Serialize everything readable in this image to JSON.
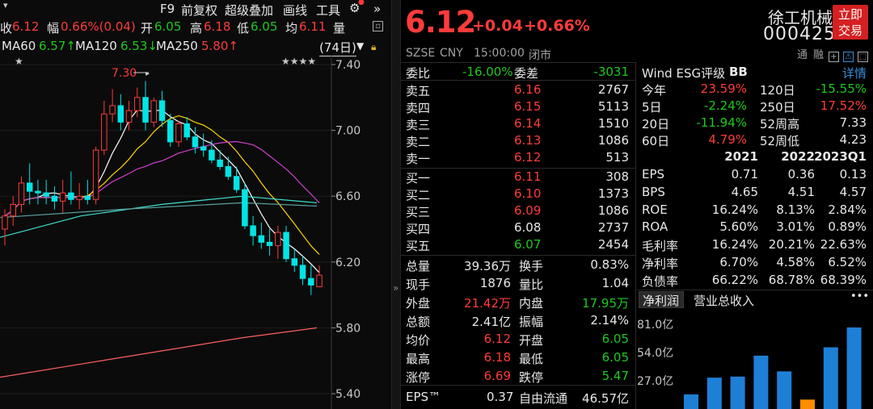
{
  "toolbar": {
    "f9": "F9",
    "restore": "前复权",
    "overlay": "超级叠加",
    "draw": "画线",
    "tools": "工具"
  },
  "ohlc": {
    "close_label": "收",
    "close": "6.12",
    "change_label": "幅",
    "change": "0.66%(0.04)",
    "open_label": "开",
    "open": "6.05",
    "high_label": "高",
    "high": "6.18",
    "low_label": "低",
    "low": "6.05",
    "avg_label": "均",
    "avg": "6.11",
    "volume_label": "量"
  },
  "ma": {
    "ma60_label": "MA60",
    "ma60": "6.57↑",
    "ma120_label": "MA120",
    "ma120": "6.53↓",
    "ma250_label": "MA250",
    "ma250": "5.80↑",
    "period": "(74日)"
  },
  "chart": {
    "y_ticks": [
      "7.40",
      "7.00",
      "6.60",
      "6.20",
      "5.80",
      "5.40"
    ],
    "high_annotation": "7.30",
    "stars_left": "★",
    "stars_right": "★★★★",
    "colors": {
      "up": "#ff3b3b",
      "down": "#00e5e5",
      "ma5": "#ffffff",
      "ma10": "#ffd700",
      "ma20": "#d040d0",
      "ma60": "#40e0d0",
      "ma250": "#ff6060"
    }
  },
  "chart_data": {
    "type": "candlestick",
    "ylim": [
      5.4,
      7.4
    ],
    "candles": [
      [
        6.4,
        6.52,
        6.3,
        6.48
      ],
      [
        6.48,
        6.6,
        6.42,
        6.55
      ],
      [
        6.55,
        6.72,
        6.5,
        6.68
      ],
      [
        6.68,
        6.8,
        6.55,
        6.63
      ],
      [
        6.63,
        6.7,
        6.55,
        6.62
      ],
      [
        6.62,
        6.7,
        6.55,
        6.6
      ],
      [
        6.6,
        6.66,
        6.52,
        6.57
      ],
      [
        6.57,
        6.7,
        6.5,
        6.62
      ],
      [
        6.62,
        6.75,
        6.55,
        6.58
      ],
      [
        6.58,
        6.68,
        6.52,
        6.6
      ],
      [
        6.6,
        6.7,
        6.55,
        6.58
      ],
      [
        6.58,
        6.9,
        6.55,
        6.88
      ],
      [
        6.88,
        7.18,
        6.85,
        7.1
      ],
      [
        7.1,
        7.25,
        7.05,
        7.15
      ],
      [
        7.15,
        7.22,
        7.0,
        7.05
      ],
      [
        7.05,
        7.18,
        7.0,
        7.12
      ],
      [
        7.12,
        7.26,
        7.08,
        7.2
      ],
      [
        7.2,
        7.3,
        7.0,
        7.05
      ],
      [
        7.05,
        7.2,
        7.02,
        7.18
      ],
      [
        7.18,
        7.24,
        7.02,
        7.06
      ],
      [
        7.06,
        7.1,
        6.9,
        6.93
      ],
      [
        6.93,
        7.06,
        6.9,
        7.04
      ],
      [
        7.04,
        7.08,
        6.94,
        6.96
      ],
      [
        6.96,
        7.02,
        6.86,
        6.9
      ],
      [
        6.9,
        6.98,
        6.84,
        6.88
      ],
      [
        6.88,
        6.94,
        6.8,
        6.82
      ],
      [
        6.82,
        6.88,
        6.76,
        6.78
      ],
      [
        6.78,
        6.84,
        6.7,
        6.72
      ],
      [
        6.72,
        6.78,
        6.62,
        6.64
      ],
      [
        6.64,
        6.68,
        6.4,
        6.42
      ],
      [
        6.42,
        6.48,
        6.3,
        6.36
      ],
      [
        6.36,
        6.44,
        6.28,
        6.32
      ],
      [
        6.32,
        6.4,
        6.24,
        6.3
      ],
      [
        6.3,
        6.42,
        6.22,
        6.38
      ],
      [
        6.38,
        6.42,
        6.2,
        6.22
      ],
      [
        6.22,
        6.28,
        6.14,
        6.18
      ],
      [
        6.18,
        6.24,
        6.06,
        6.1
      ],
      [
        6.1,
        6.18,
        6.0,
        6.06
      ],
      [
        6.05,
        6.18,
        6.05,
        6.12
      ]
    ]
  },
  "quote": {
    "price": "6.12",
    "change": "+0.04",
    "change_pct": "+0.66%",
    "name": "徐工机械",
    "code": "000425",
    "trade_button": "立即交易",
    "exchange": "SZSE",
    "currency": "CNY",
    "time": "15:00:00",
    "status": "闭市",
    "flags": [
      "通",
      "融"
    ]
  },
  "orderbook": {
    "wb_label": "委比",
    "wb": "-16.00%",
    "wc_label": "委差",
    "wc": "-3031",
    "asks": [
      {
        "label": "卖五",
        "price": "6.16",
        "vol": "2767"
      },
      {
        "label": "卖四",
        "price": "6.15",
        "vol": "5113"
      },
      {
        "label": "卖三",
        "price": "6.14",
        "vol": "1510"
      },
      {
        "label": "卖二",
        "price": "6.13",
        "vol": "1086"
      },
      {
        "label": "卖一",
        "price": "6.12",
        "vol": "513"
      }
    ],
    "bids": [
      {
        "label": "买一",
        "price": "6.11",
        "vol": "308"
      },
      {
        "label": "买二",
        "price": "6.10",
        "vol": "1373"
      },
      {
        "label": "买三",
        "price": "6.09",
        "vol": "1086"
      },
      {
        "label": "买四",
        "price": "6.08",
        "vol": "2737"
      },
      {
        "label": "买五",
        "price": "6.07",
        "vol": "2454"
      }
    ]
  },
  "stats": [
    {
      "l1": "总量",
      "v1": "39.36万",
      "l2": "换手",
      "v2": "0.83%"
    },
    {
      "l1": "现手",
      "v1": "1876",
      "l2": "量比",
      "v2": "1.04"
    },
    {
      "l1": "外盘",
      "v1": "21.42万",
      "l2": "内盘",
      "v2": "17.95万"
    },
    {
      "l1": "总额",
      "v1": "2.41亿",
      "l2": "振幅",
      "v2": "2.14%"
    },
    {
      "l1": "均价",
      "v1": "6.12",
      "l2": "开盘",
      "v2": "6.05"
    },
    {
      "l1": "最高",
      "v1": "6.18",
      "l2": "最低",
      "v2": "6.05"
    },
    {
      "l1": "涨停",
      "v1": "6.69",
      "l2": "跌停",
      "v2": "5.47"
    }
  ],
  "bottom": {
    "l1": "EPS™",
    "v1": "0.37",
    "l2": "自由流通",
    "v2": "46.57亿"
  },
  "esg": {
    "label": "Wind ESG评级",
    "rating": "BB",
    "detail": "详情"
  },
  "perf": [
    {
      "l1": "今年",
      "v1": "23.59%",
      "l2": "120日",
      "v2": "-15.55%"
    },
    {
      "l1": "5日",
      "v1": "-2.24%",
      "l2": "250日",
      "v2": "17.52%"
    },
    {
      "l1": "20日",
      "v1": "-11.94%",
      "l2": "52周高",
      "v2": "7.33"
    },
    {
      "l1": "60日",
      "v1": "4.79%",
      "l2": "52周低",
      "v2": "4.23"
    }
  ],
  "fin": {
    "years": [
      "2021",
      "2022",
      "2023Q1"
    ],
    "rows": [
      {
        "label": "EPS",
        "vals": [
          "0.71",
          "0.36",
          "0.13"
        ]
      },
      {
        "label": "BPS",
        "vals": [
          "4.65",
          "4.51",
          "4.57"
        ]
      },
      {
        "label": "ROE",
        "vals": [
          "16.24%",
          "8.13%",
          "2.84%"
        ]
      },
      {
        "label": "ROA",
        "vals": [
          "5.60%",
          "3.01%",
          "0.89%"
        ]
      },
      {
        "label": "毛利率",
        "vals": [
          "16.24%",
          "20.21%",
          "22.63%"
        ]
      },
      {
        "label": "净利率",
        "vals": [
          "6.70%",
          "4.58%",
          "6.52%"
        ]
      },
      {
        "label": "负债率",
        "vals": [
          "66.22%",
          "68.78%",
          "68.39%"
        ]
      }
    ]
  },
  "profit": {
    "tab1": "净利润",
    "tab2": "营业总收入",
    "more": "•••",
    "y_ticks": [
      "81.0亿",
      "54.0亿",
      "27.0亿"
    ],
    "bars": [
      {
        "v": 14,
        "c": "#1e7fd6"
      },
      {
        "v": 30,
        "c": "#1e7fd6"
      },
      {
        "v": 31,
        "c": "#1e7fd6"
      },
      {
        "v": 51,
        "c": "#1e7fd6"
      },
      {
        "v": 36,
        "c": "#1e7fd6"
      },
      {
        "v": 9,
        "c": "#ff8c00"
      },
      {
        "v": 59,
        "c": "#1e7fd6"
      },
      {
        "v": 78,
        "c": "#1e7fd6"
      }
    ]
  }
}
